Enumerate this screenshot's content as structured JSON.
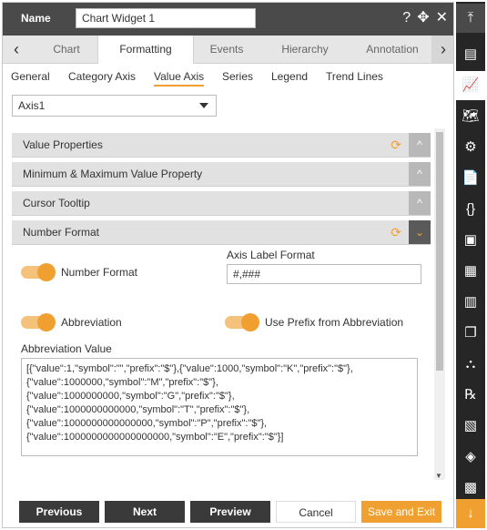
{
  "header": {
    "name_label": "Name",
    "name_value": "Chart Widget 1",
    "help_glyph": "?",
    "move_glyph": "✥",
    "close_glyph": "✕"
  },
  "tabs": {
    "left_arrow": "‹",
    "right_arrow": "›",
    "items": [
      {
        "label": "Chart"
      },
      {
        "label": "Formatting",
        "active": true
      },
      {
        "label": "Events"
      },
      {
        "label": "Hierarchy"
      },
      {
        "label": "Annotation"
      }
    ]
  },
  "subtabs": [
    {
      "label": "General"
    },
    {
      "label": "Category Axis"
    },
    {
      "label": "Value Axis",
      "active": true
    },
    {
      "label": "Series"
    },
    {
      "label": "Legend"
    },
    {
      "label": "Trend Lines"
    }
  ],
  "axis_select": {
    "value": "Axis1"
  },
  "sections": [
    {
      "title": "Value Properties",
      "toggle": "^",
      "refresh": "⟳"
    },
    {
      "title": "Minimum & Maximum Value Property",
      "toggle": "^"
    },
    {
      "title": "Cursor Tooltip",
      "toggle": "^"
    },
    {
      "title": "Number Format",
      "toggle": "⌄",
      "refresh": "⟳"
    }
  ],
  "number_format": {
    "number_format_label": "Number Format",
    "axis_label_format_label": "Axis Label Format",
    "axis_label_format_value": "#,###",
    "abbreviation_label": "Abbreviation",
    "use_prefix_label": "Use Prefix from Abbreviation",
    "abbreviation_value_label": "Abbreviation Value",
    "abbreviation_value": "[{\"value\":1,\"symbol\":\"\",\"prefix\":\"$\"},{\"value\":1000,\"symbol\":\"K\",\"prefix\":\"$\"},\n{\"value\":1000000,\"symbol\":\"M\",\"prefix\":\"$\"},\n{\"value\":1000000000,\"symbol\":\"G\",\"prefix\":\"$\"},\n{\"value\":1000000000000,\"symbol\":\"T\",\"prefix\":\"$\"},\n{\"value\":1000000000000000,\"symbol\":\"P\",\"prefix\":\"$\"},\n{\"value\":1000000000000000000,\"symbol\":\"E\",\"prefix\":\"$\"}]"
  },
  "footer": {
    "previous": "Previous",
    "next": "Next",
    "preview": "Preview",
    "cancel": "Cancel",
    "save_exit": "Save and Exit"
  },
  "sidebar": {
    "top_icon": "⤒",
    "bottom_icon": "↓",
    "icons": [
      {
        "name": "table-icon",
        "glyph": "▤"
      },
      {
        "name": "line-chart-icon",
        "glyph": "📈"
      },
      {
        "name": "map-icon",
        "glyph": "🗺"
      },
      {
        "name": "document-settings-icon",
        "glyph": "⚙"
      },
      {
        "name": "document-icon",
        "glyph": "📄"
      },
      {
        "name": "braces-icon",
        "glyph": "{}"
      },
      {
        "name": "image-icon",
        "glyph": "▣"
      },
      {
        "name": "layout-icon",
        "glyph": "▦"
      },
      {
        "name": "bar-chart-icon",
        "glyph": "▥"
      },
      {
        "name": "copy-icon",
        "glyph": "❐"
      },
      {
        "name": "hierarchy-icon",
        "glyph": "⛬"
      },
      {
        "name": "rx-icon",
        "glyph": "℞"
      },
      {
        "name": "clipboard-icon",
        "glyph": "▧"
      },
      {
        "name": "layers-icon",
        "glyph": "◈"
      },
      {
        "name": "grid-icon",
        "glyph": "▩"
      }
    ]
  },
  "colors": {
    "accent": "#f0a030",
    "dark": "#3a3a3a",
    "topbar": "#4a4a4a"
  }
}
